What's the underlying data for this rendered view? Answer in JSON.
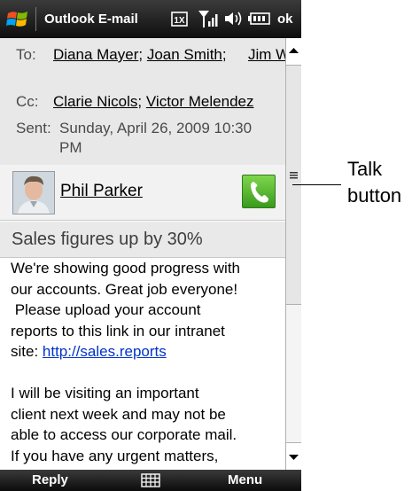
{
  "titlebar": {
    "title": "Outlook E-mail",
    "ok_label": "ok",
    "icons": [
      "windows-start-icon",
      "network-1x-icon",
      "signal-icon",
      "speaker-icon",
      "battery-icon"
    ]
  },
  "header": {
    "to_label": "To:",
    "to_recipients": [
      "Diana Mayer",
      "Joan Smith",
      "Jim Wong"
    ],
    "to_separator": ";",
    "cc_label": "Cc:",
    "cc_recipients": [
      "Clarie Nicols",
      "Victor Melendez"
    ],
    "sent_label": "Sent:",
    "sent_line1": "Sunday, April 26, 2009 10:30",
    "sent_line2": "PM"
  },
  "contact": {
    "name": "Phil Parker"
  },
  "message": {
    "subject": "Sales figures up by 30%",
    "body_lines": [
      "We're showing good progress with",
      "our accounts. Great job everyone!",
      " Please upload your account",
      "reports to this link in our intranet"
    ],
    "link_prefix": "site: ",
    "link_text": "http://sales.reports",
    "body_lines_2": [
      "I will be visiting an important",
      "client next week and may not be",
      "able to access our corporate mail.",
      "If you have any urgent matters,"
    ]
  },
  "softkeys": {
    "left": "Reply",
    "right": "Menu"
  },
  "callout": {
    "line1": "Talk",
    "line2": "button"
  },
  "colors": {
    "talk_green": "#4cb82a",
    "link_blue": "#0033cc",
    "bar_dark": "#0e0e0e"
  }
}
